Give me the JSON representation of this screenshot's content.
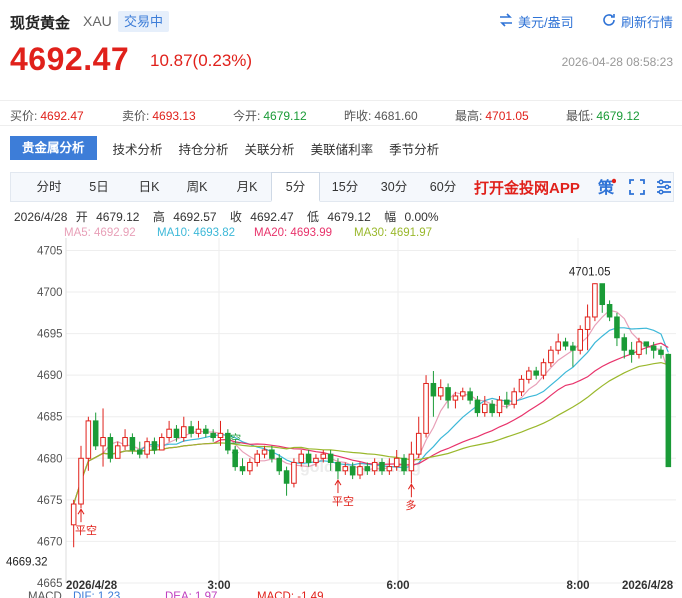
{
  "header": {
    "title": "现货黄金",
    "symbol": "XAU",
    "status_tag": "交易中",
    "currency_btn": "美元/盎司",
    "refresh_btn": "刷新行情",
    "price": "4692.47",
    "change": "10.87(0.23%)",
    "timestamp": "2026-04-28 08:58:23"
  },
  "quotes": {
    "buy": {
      "label": "买价:",
      "value": "4692.47"
    },
    "sell": {
      "label": "卖价:",
      "value": "4693.13"
    },
    "open": {
      "label": "今开:",
      "value": "4679.12"
    },
    "prev_close": {
      "label": "昨收:",
      "value": "4681.60"
    },
    "high": {
      "label": "最高:",
      "value": "4701.05"
    },
    "low": {
      "label": "最低:",
      "value": "4679.12"
    }
  },
  "analysis_tabs": [
    "贵金属分析",
    "技术分析",
    "持仓分析",
    "关联分析",
    "美联储利率",
    "季节分析"
  ],
  "periods": [
    "分时",
    "5日",
    "日K",
    "周K",
    "月K",
    "5分",
    "15分",
    "30分",
    "60分"
  ],
  "active_period": "5分",
  "app_link": "打开金投网APP",
  "tool_icons": [
    "strategy-icon",
    "fullscreen-icon",
    "settings-icon"
  ],
  "strategy_glyph": "策",
  "ohlc": {
    "date": "2026/4/28",
    "open_label": "开",
    "open": "4679.12",
    "high_label": "高",
    "high": "4692.57",
    "close_label": "收",
    "close": "4692.47",
    "low_label": "低",
    "low": "4679.12",
    "amp_label": "幅",
    "amp": "0.00%"
  },
  "ma_legend": [
    {
      "label": "MA5: 4692.92",
      "color": "#e8a0b8"
    },
    {
      "label": "MA10: 4693.82",
      "color": "#3cb8d8"
    },
    {
      "label": "MA20: 4693.99",
      "color": "#e8336b"
    },
    {
      "label": "MA30: 4691.97",
      "color": "#9ab82c"
    }
  ],
  "macd_legend": [
    {
      "label": "MACD",
      "color": "#555555"
    },
    {
      "label": "DIF: 1.23",
      "color": "#3d7dd8"
    },
    {
      "label": "DEA: 1.97",
      "color": "#c040c0"
    },
    {
      "label": "MACD: -1.49",
      "color": "#e0211b"
    }
  ],
  "watermark": "gold.cngold.org",
  "chart_data": {
    "type": "candlestick",
    "y_ticks": [
      "4705",
      "4700",
      "4695",
      "4690",
      "4685",
      "4680",
      "4675",
      "4670",
      "4665"
    ],
    "ylim": [
      4665,
      4706.5
    ],
    "x_ticks": [
      "2026/4/28",
      "3:00",
      "6:00",
      "8:00",
      "2026/4/28"
    ],
    "annotations": [
      {
        "text": "4701.05",
        "type": "high"
      },
      {
        "text": "4669.32",
        "type": "low"
      },
      {
        "text": "平空",
        "type": "signal"
      },
      {
        "text": "空",
        "type": "signal"
      },
      {
        "text": "平空",
        "type": "signal"
      },
      {
        "text": "多",
        "type": "signal"
      }
    ],
    "candles": [
      [
        4672.0,
        4674.5,
        4669.3,
        4675.0
      ],
      [
        4674.5,
        4680.0,
        4674.0,
        4681.5
      ],
      [
        4680.0,
        4684.5,
        4678.5,
        4685.0
      ],
      [
        4684.5,
        4681.5,
        4681.0,
        4685.5
      ],
      [
        4681.5,
        4682.5,
        4679.0,
        4686.0
      ],
      [
        4682.5,
        4680.0,
        4679.5,
        4683.0
      ],
      [
        4680.0,
        4681.5,
        4680.0,
        4682.0
      ],
      [
        4681.5,
        4682.5,
        4681.0,
        4683.5
      ],
      [
        4682.5,
        4681.0,
        4680.5,
        4683.0
      ],
      [
        4681.0,
        4680.5,
        4680.0,
        4682.0
      ],
      [
        4680.5,
        4682.0,
        4680.0,
        4682.5
      ],
      [
        4682.0,
        4681.0,
        4680.5,
        4682.5
      ],
      [
        4681.0,
        4682.5,
        4681.0,
        4683.0
      ],
      [
        4682.5,
        4683.5,
        4682.0,
        4684.5
      ],
      [
        4683.5,
        4682.5,
        4682.0,
        4684.0
      ],
      [
        4682.5,
        4683.8,
        4682.0,
        4685.0
      ],
      [
        4683.8,
        4683.0,
        4682.5,
        4684.5
      ],
      [
        4683.0,
        4683.5,
        4682.5,
        4684.5
      ],
      [
        4683.5,
        4683.0,
        4682.5,
        4684.0
      ],
      [
        4683.0,
        4682.5,
        4682.0,
        4683.5
      ],
      [
        4682.5,
        4683.0,
        4681.5,
        4684.5
      ],
      [
        4683.0,
        4681.0,
        4680.5,
        4683.5
      ],
      [
        4681.0,
        4679.0,
        4678.5,
        4681.5
      ],
      [
        4679.0,
        4678.5,
        4678.0,
        4680.0
      ],
      [
        4678.5,
        4679.5,
        4678.0,
        4680.0
      ],
      [
        4679.5,
        4680.5,
        4679.0,
        4681.0
      ],
      [
        4680.5,
        4681.0,
        4680.0,
        4681.5
      ],
      [
        4681.0,
        4680.0,
        4679.5,
        4681.5
      ],
      [
        4680.0,
        4678.5,
        4678.0,
        4680.5
      ],
      [
        4678.5,
        4677.0,
        4675.5,
        4679.0
      ],
      [
        4677.0,
        4679.5,
        4676.5,
        4680.0
      ],
      [
        4679.5,
        4680.5,
        4679.0,
        4681.0
      ],
      [
        4680.5,
        4679.5,
        4679.0,
        4681.0
      ],
      [
        4679.5,
        4680.0,
        4679.0,
        4680.5
      ],
      [
        4680.0,
        4680.5,
        4679.5,
        4681.0
      ],
      [
        4680.5,
        4679.5,
        4678.5,
        4681.0
      ],
      [
        4679.5,
        4678.5,
        4677.5,
        4680.0
      ],
      [
        4678.5,
        4679.0,
        4678.0,
        4679.5
      ],
      [
        4679.0,
        4678.0,
        4677.5,
        4679.5
      ],
      [
        4678.0,
        4679.0,
        4677.5,
        4679.5
      ],
      [
        4679.0,
        4678.5,
        4678.0,
        4679.5
      ],
      [
        4678.5,
        4679.5,
        4678.0,
        4680.0
      ],
      [
        4679.5,
        4678.5,
        4678.0,
        4680.0
      ],
      [
        4678.5,
        4679.0,
        4678.0,
        4680.0
      ],
      [
        4679.0,
        4680.0,
        4678.5,
        4681.0
      ],
      [
        4680.0,
        4678.5,
        4678.0,
        4680.5
      ],
      [
        4678.5,
        4680.5,
        4677.0,
        4682.0
      ],
      [
        4680.5,
        4683.0,
        4680.0,
        4685.0
      ],
      [
        4683.0,
        4689.0,
        4682.5,
        4690.0
      ],
      [
        4689.0,
        4687.5,
        4685.0,
        4690.5
      ],
      [
        4687.5,
        4688.5,
        4687.0,
        4689.5
      ],
      [
        4688.5,
        4687.0,
        4686.0,
        4689.0
      ],
      [
        4687.0,
        4687.5,
        4686.0,
        4688.0
      ],
      [
        4687.5,
        4688.0,
        4687.0,
        4688.5
      ],
      [
        4688.0,
        4687.0,
        4686.5,
        4688.5
      ],
      [
        4687.0,
        4685.5,
        4685.0,
        4687.5
      ],
      [
        4685.5,
        4686.5,
        4685.0,
        4687.5
      ],
      [
        4686.5,
        4685.5,
        4685.0,
        4687.0
      ],
      [
        4685.5,
        4687.0,
        4685.0,
        4687.5
      ],
      [
        4687.0,
        4686.5,
        4686.0,
        4688.0
      ],
      [
        4686.5,
        4688.0,
        4686.0,
        4688.5
      ],
      [
        4688.0,
        4689.5,
        4687.5,
        4690.0
      ],
      [
        4689.5,
        4690.5,
        4689.0,
        4691.0
      ],
      [
        4690.5,
        4690.0,
        4689.5,
        4691.0
      ],
      [
        4690.0,
        4691.5,
        4689.5,
        4692.0
      ],
      [
        4691.5,
        4693.0,
        4691.0,
        4693.5
      ],
      [
        4693.0,
        4694.0,
        4692.5,
        4695.0
      ],
      [
        4694.0,
        4693.5,
        4693.0,
        4694.5
      ],
      [
        4693.5,
        4693.0,
        4691.0,
        4694.0
      ],
      [
        4693.0,
        4695.5,
        4692.5,
        4696.0
      ],
      [
        4695.5,
        4697.0,
        4693.0,
        4698.5
      ],
      [
        4697.0,
        4701.0,
        4696.5,
        4701.05
      ],
      [
        4701.0,
        4698.5,
        4697.5,
        4701.0
      ],
      [
        4698.5,
        4697.0,
        4696.5,
        4699.0
      ],
      [
        4697.0,
        4694.5,
        4693.5,
        4697.5
      ],
      [
        4694.5,
        4693.0,
        4692.0,
        4695.0
      ],
      [
        4693.0,
        4692.5,
        4691.5,
        4694.0
      ],
      [
        4692.5,
        4694.0,
        4692.0,
        4694.5
      ],
      [
        4694.0,
        4693.5,
        4692.5,
        4694.0
      ],
      [
        4693.5,
        4693.0,
        4692.0,
        4694.0
      ],
      [
        4693.0,
        4692.5,
        4692.0,
        4693.5
      ],
      [
        4692.5,
        4679.0,
        4679.0,
        4692.6
      ]
    ]
  }
}
